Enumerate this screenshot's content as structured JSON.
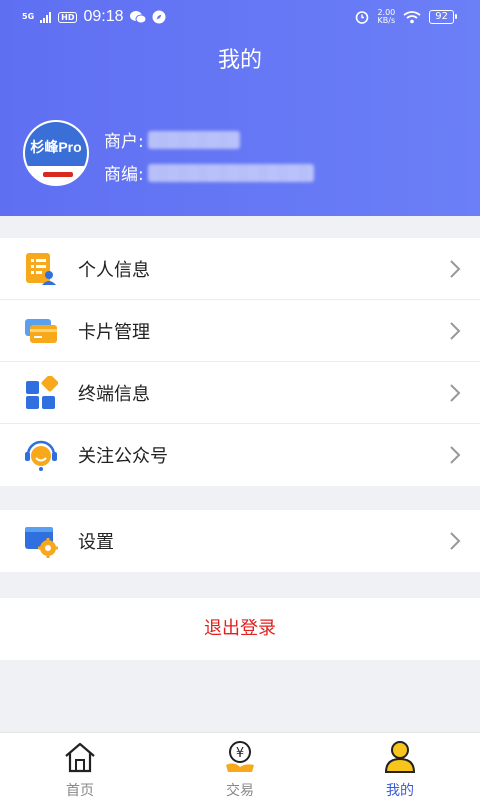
{
  "status_bar": {
    "network": "5G",
    "hd": "HD",
    "time": "09:18",
    "speed_value": "2.00",
    "speed_unit": "KB/s",
    "battery": "92"
  },
  "header": {
    "title": "我的",
    "avatar_brand": "杉峰Pro",
    "merchant_label": "商户:",
    "merchant_code_label": "商编:"
  },
  "menu": {
    "items": [
      {
        "label": "个人信息",
        "icon": "personal-info-icon"
      },
      {
        "label": "卡片管理",
        "icon": "card-icon"
      },
      {
        "label": "终端信息",
        "icon": "terminal-icon"
      },
      {
        "label": "关注公众号",
        "icon": "customer-service-icon"
      }
    ],
    "settings": {
      "label": "设置",
      "icon": "settings-icon"
    }
  },
  "logout_label": "退出登录",
  "tabbar": {
    "tabs": [
      {
        "label": "首页",
        "icon": "home-icon",
        "active": false
      },
      {
        "label": "交易",
        "icon": "yuan-hand-icon",
        "active": false
      },
      {
        "label": "我的",
        "icon": "user-icon",
        "active": true
      }
    ]
  },
  "colors": {
    "header_bg": "#6676f4",
    "accent_blue": "#3b5bdb",
    "logout_red": "#e02121",
    "icon_orange": "#f7a81b"
  }
}
